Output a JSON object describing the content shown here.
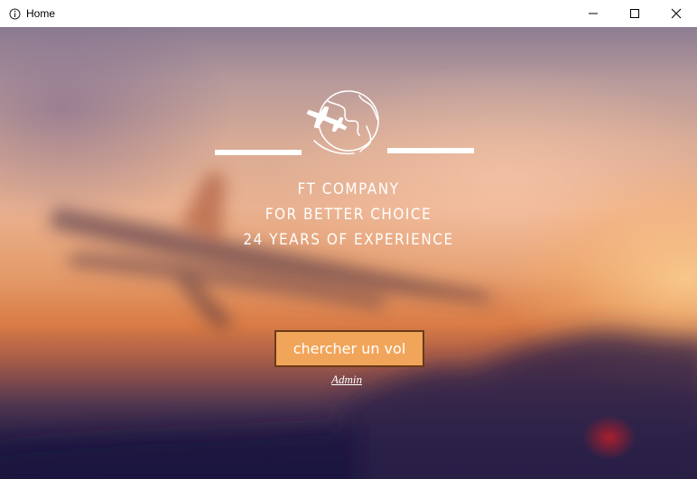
{
  "window": {
    "title": "Home",
    "controls": [
      "minimize",
      "maximize",
      "close"
    ]
  },
  "hero": {
    "company": "FT COMPANY",
    "slogan": "FOR BETTER CHOICE",
    "experience": "24 YEARS OF EXPERIENCE",
    "logo_icon": "globe-plane-icon",
    "background": "blurred airplane at sunset"
  },
  "actions": {
    "search_label": "chercher un vol",
    "admin_label": "Admin"
  },
  "colors": {
    "button_bg": "#f1a55a",
    "button_border": "#6a3b16",
    "text": "#ffffff"
  }
}
